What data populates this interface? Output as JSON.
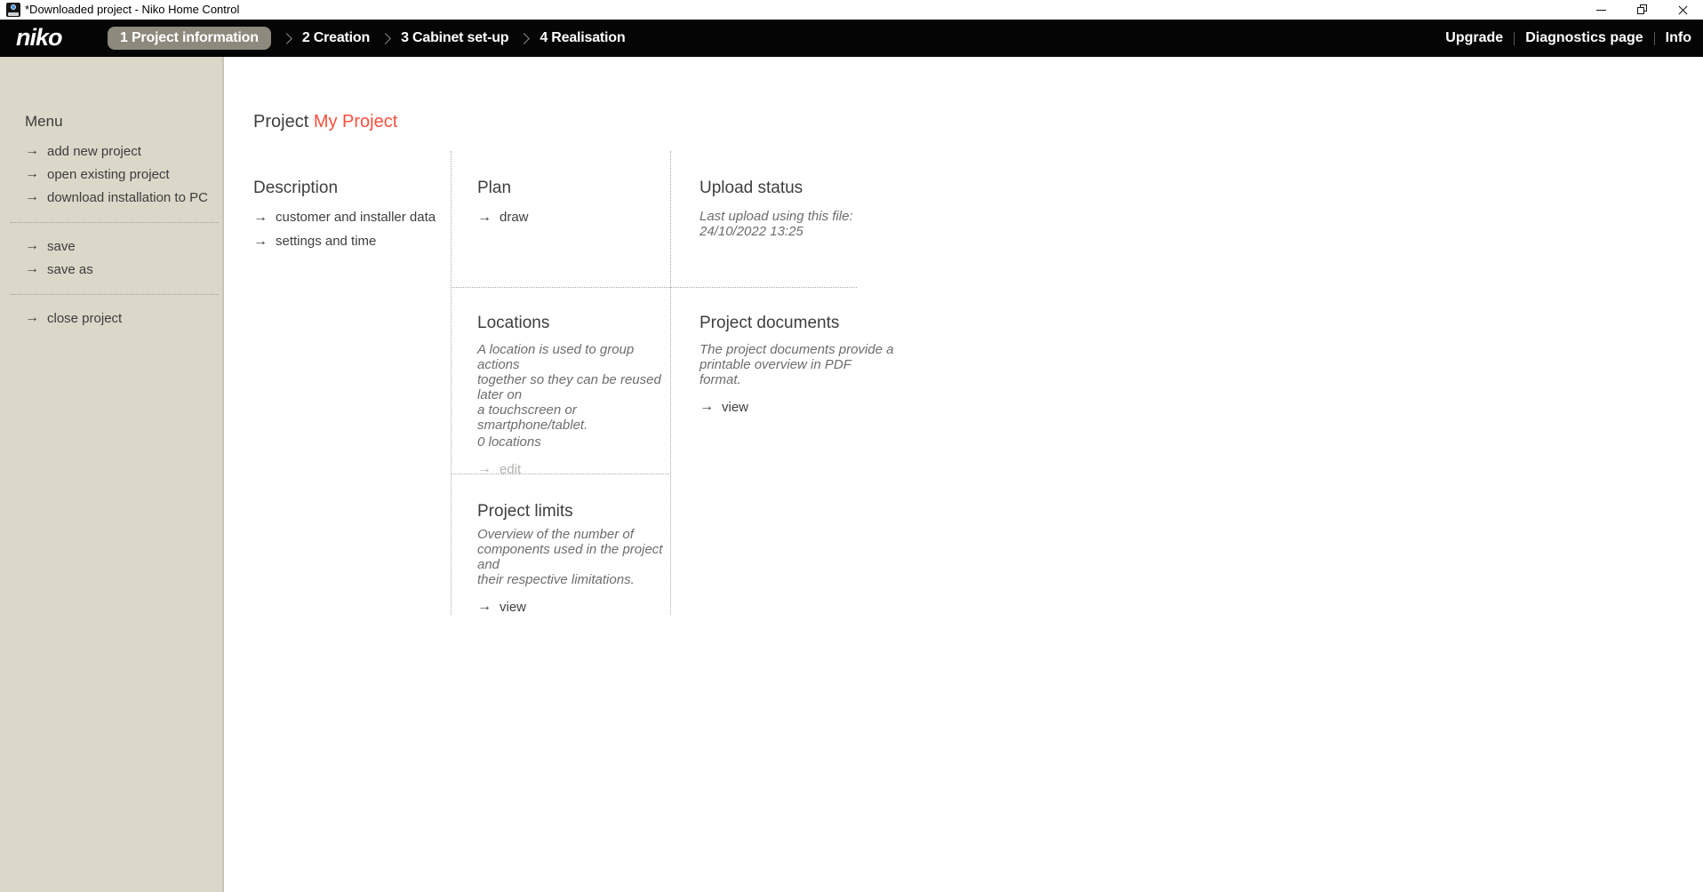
{
  "window": {
    "title": "*Downloaded project - Niko Home Control"
  },
  "navbar": {
    "logo": "niko",
    "tabs": [
      {
        "label": "1 Project information",
        "active": true
      },
      {
        "label": "2 Creation",
        "active": false
      },
      {
        "label": "3 Cabinet set-up",
        "active": false
      },
      {
        "label": "4 Realisation",
        "active": false
      }
    ],
    "right_links": [
      {
        "label": "Upgrade"
      },
      {
        "label": "Diagnostics page"
      },
      {
        "label": "Info"
      }
    ]
  },
  "sidebar": {
    "heading": "Menu",
    "groups": [
      {
        "items": [
          {
            "label": "add new project"
          },
          {
            "label": "open existing project"
          },
          {
            "label": "download installation to PC"
          }
        ]
      },
      {
        "items": [
          {
            "label": "save"
          },
          {
            "label": "save as"
          }
        ]
      },
      {
        "items": [
          {
            "label": "close project"
          }
        ]
      }
    ]
  },
  "main": {
    "title_prefix": "Project ",
    "title_project": "My Project",
    "sections": {
      "description": {
        "heading": "Description",
        "links": [
          {
            "label": "customer and installer data"
          },
          {
            "label": "settings and time"
          }
        ]
      },
      "plan": {
        "heading": "Plan",
        "link": "draw"
      },
      "upload_status": {
        "heading": "Upload status",
        "note": "Last upload using this file:\n24/10/2022 13:25"
      },
      "locations": {
        "heading": "Locations",
        "description": "A location is used to group actions\ntogether so they can be reused later on\na touchscreen or smartphone/tablet.",
        "count": "0 locations",
        "link": "edit"
      },
      "project_documents": {
        "heading": "Project documents",
        "description": "The project documents provide a\nprintable overview in PDF format.",
        "link": "view"
      },
      "project_limits": {
        "heading": "Project limits",
        "description": "Overview of the number of\ncomponents used in the project and\ntheir respective limitations.",
        "link": "view"
      }
    }
  },
  "icons": {
    "arrow_right": "→"
  },
  "colors": {
    "accent_orange": "#f8503c",
    "navbar_bg": "#050505",
    "active_tab_bg": "#8d897c",
    "sidebar_bg": "#dbd8ca"
  }
}
